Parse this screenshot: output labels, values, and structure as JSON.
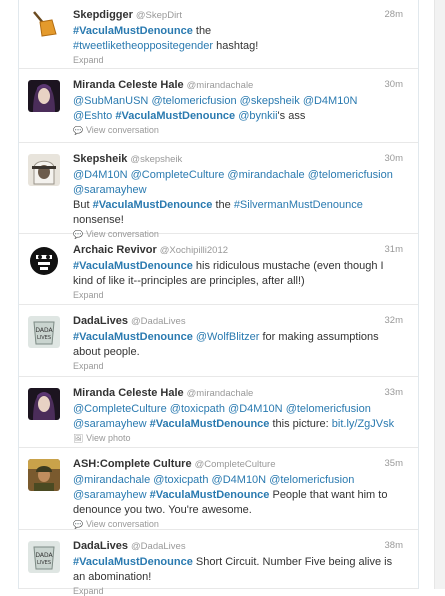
{
  "tweets": [
    {
      "fullname": "Skepdigger",
      "username": "@SkepDirt",
      "time": "28m",
      "avatar": "shovel",
      "lines": [
        [
          {
            "t": "#VaculaMustDenounce",
            "c": "hb"
          },
          {
            "t": " the",
            "c": "n"
          }
        ],
        [
          {
            "t": "#tweetliketheoppositegender",
            "c": "h"
          },
          {
            "t": " hashtag!",
            "c": "n"
          }
        ]
      ],
      "action": "Expand",
      "action_icon": ""
    },
    {
      "fullname": "Miranda Celeste Hale",
      "username": "@mirandachale",
      "time": "30m",
      "avatar": "woman",
      "lines": [
        [
          {
            "t": "@SubManUSN",
            "c": "h"
          },
          {
            "t": " ",
            "c": "n"
          },
          {
            "t": "@telomericfusion",
            "c": "h"
          },
          {
            "t": " ",
            "c": "n"
          },
          {
            "t": "@skepsheik",
            "c": "h"
          },
          {
            "t": " ",
            "c": "n"
          },
          {
            "t": "@D4M10N",
            "c": "h"
          }
        ],
        [
          {
            "t": "@Eshto",
            "c": "h"
          },
          {
            "t": " ",
            "c": "n"
          },
          {
            "t": "#VaculaMustDenounce",
            "c": "hb"
          },
          {
            "t": " ",
            "c": "n"
          },
          {
            "t": "@bynkii",
            "c": "h"
          },
          {
            "t": "'s ass",
            "c": "n"
          }
        ]
      ],
      "action": "View conversation",
      "action_icon": "speech-icon"
    },
    {
      "fullname": "Skepsheik",
      "username": "@skepsheik",
      "time": "30m",
      "avatar": "sheik",
      "lines": [
        [
          {
            "t": "@D4M10N",
            "c": "h"
          },
          {
            "t": " ",
            "c": "n"
          },
          {
            "t": "@CompleteCulture",
            "c": "h"
          },
          {
            "t": " ",
            "c": "n"
          },
          {
            "t": "@mirandachale",
            "c": "h"
          },
          {
            "t": " ",
            "c": "n"
          },
          {
            "t": "@telomericfusion",
            "c": "h"
          }
        ],
        [
          {
            "t": "@saramayhew",
            "c": "h"
          }
        ],
        [
          {
            "t": "But ",
            "c": "n"
          },
          {
            "t": "#VaculaMustDenounce",
            "c": "hb"
          },
          {
            "t": "  the ",
            "c": "n"
          },
          {
            "t": "#SilvermanMustDenounce",
            "c": "h"
          }
        ],
        [
          {
            "t": "nonsense!",
            "c": "n"
          }
        ]
      ],
      "action": "View conversation",
      "action_icon": "speech-icon"
    },
    {
      "fullname": "Archaic Revivor",
      "username": "@Xochipilli2012",
      "time": "31m",
      "avatar": "aztec",
      "lines": [
        [
          {
            "t": "#VaculaMustDenounce",
            "c": "hb"
          },
          {
            "t": " his ridiculous mustache (even though I",
            "c": "n"
          }
        ],
        [
          {
            "t": "kind of like it--principles are principles, after all!)",
            "c": "n"
          }
        ]
      ],
      "action": "Expand",
      "action_icon": ""
    },
    {
      "fullname": "DadaLives",
      "username": "@DadaLives",
      "time": "32m",
      "avatar": "dada",
      "lines": [
        [
          {
            "t": "#VaculaMustDenounce",
            "c": "hb"
          },
          {
            "t": " ",
            "c": "n"
          },
          {
            "t": "@WolfBlitzer",
            "c": "h"
          },
          {
            "t": " for making assumptions",
            "c": "n"
          }
        ],
        [
          {
            "t": "about people.",
            "c": "n"
          }
        ]
      ],
      "action": "Expand",
      "action_icon": ""
    },
    {
      "fullname": "Miranda Celeste Hale",
      "username": "@mirandachale",
      "time": "33m",
      "avatar": "woman",
      "lines": [
        [
          {
            "t": "@CompleteCulture",
            "c": "h"
          },
          {
            "t": " ",
            "c": "n"
          },
          {
            "t": "@toxicpath",
            "c": "h"
          },
          {
            "t": " ",
            "c": "n"
          },
          {
            "t": "@D4M10N",
            "c": "h"
          },
          {
            "t": " ",
            "c": "n"
          },
          {
            "t": "@telomericfusion",
            "c": "h"
          }
        ],
        [
          {
            "t": "@saramayhew",
            "c": "h"
          },
          {
            "t": " ",
            "c": "n"
          },
          {
            "t": "#VaculaMustDenounce",
            "c": "hb"
          },
          {
            "t": " this picture: ",
            "c": "n"
          },
          {
            "t": "bit.ly/ZgJVsk",
            "c": "h"
          }
        ]
      ],
      "action": "View photo",
      "action_icon": "photo-icon"
    },
    {
      "fullname": "ASH:Complete Culture",
      "username": "@CompleteCulture",
      "time": "35m",
      "avatar": "soldier",
      "lines": [
        [
          {
            "t": "@mirandachale",
            "c": "h"
          },
          {
            "t": " ",
            "c": "n"
          },
          {
            "t": "@toxicpath",
            "c": "h"
          },
          {
            "t": " ",
            "c": "n"
          },
          {
            "t": "@D4M10N",
            "c": "h"
          },
          {
            "t": " ",
            "c": "n"
          },
          {
            "t": "@telomericfusion",
            "c": "h"
          }
        ],
        [
          {
            "t": "@saramayhew",
            "c": "h"
          },
          {
            "t": " ",
            "c": "n"
          },
          {
            "t": "#VaculaMustDenounce",
            "c": "hb"
          },
          {
            "t": " People that want him to",
            "c": "n"
          }
        ],
        [
          {
            "t": "denounce you two. You're awesome.",
            "c": "n"
          }
        ]
      ],
      "action": "View conversation",
      "action_icon": "speech-icon"
    },
    {
      "fullname": "DadaLives",
      "username": "@DadaLives",
      "time": "38m",
      "avatar": "dada",
      "lines": [
        [
          {
            "t": "#VaculaMustDenounce",
            "c": "hb"
          },
          {
            "t": " Short Circuit. Number Five being alive is",
            "c": "n"
          }
        ],
        [
          {
            "t": "an abomination!",
            "c": "n"
          }
        ]
      ],
      "action": "Expand",
      "action_icon": ""
    }
  ]
}
